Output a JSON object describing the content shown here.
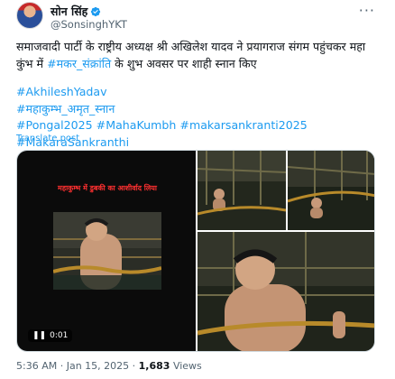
{
  "author": {
    "display_name": "सोन सिंह",
    "handle": "@SonsinghYKT"
  },
  "post": {
    "text_before": "समाजवादी पार्टी के राष्ट्रीय अध्यक्ष श्री अखिलेश यादव ने प्रयागराज संगम पहुंचकर महा कुंभ में ",
    "text_link": "#मकर_संक्रांति",
    "text_after": " के शुभ अवसर पर शाही स्नान किए",
    "hashtag_line1": "#AkhileshYadav",
    "hashtag_line2": "#महाकुम्भ_अमृत_स्नान",
    "hashtag_line3": [
      "#Pongal2025",
      "#MahaKumbh",
      "#makarsankranti2025",
      "#MakaraSankranthi"
    ],
    "translate_label": "Translate post"
  },
  "media": {
    "video_overlay_text": "महाकुम्भ में डुबकी का आशीर्वाद लिया",
    "video_time": "0:01"
  },
  "meta": {
    "time": "5:36 AM",
    "date": "Jan 15, 2025",
    "views_count": "1,683",
    "views_label": "Views"
  },
  "colors": {
    "link": "#1d9bf0",
    "verified": "#1d9bf0"
  },
  "icons": [
    "verified-badge-icon",
    "more-options-icon",
    "play-icon"
  ]
}
